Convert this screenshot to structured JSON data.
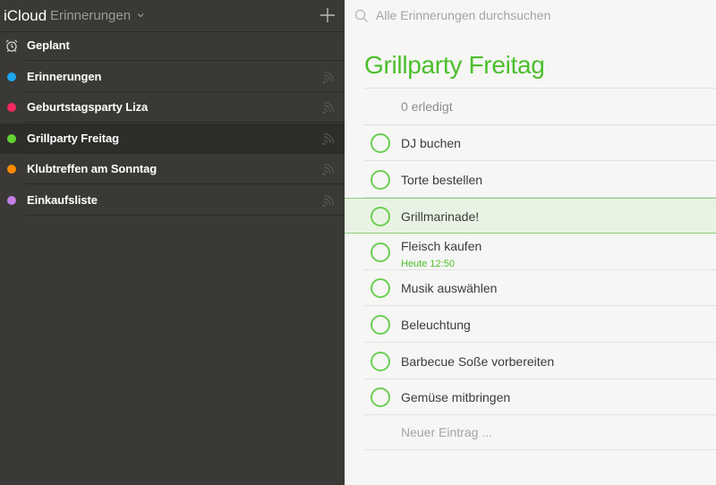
{
  "header": {
    "app_name": "iCloud",
    "app_section": "Erinnerungen"
  },
  "sidebar": {
    "scheduled_label": "Geplant",
    "lists": [
      {
        "label": "Erinnerungen",
        "color": "#1ea8ef"
      },
      {
        "label": "Geburtstagsparty Liza",
        "color": "#f2285f"
      },
      {
        "label": "Grillparty Freitag",
        "color": "#62d233"
      },
      {
        "label": "Klubtreffen am Sonntag",
        "color": "#ff8a00"
      },
      {
        "label": "Einkaufsliste",
        "color": "#c27ee3"
      }
    ],
    "selected_list": "Grillparty Freitag"
  },
  "search": {
    "placeholder": "Alle Erinnerungen durchsuchen"
  },
  "main": {
    "title": "Grillparty Freitag",
    "completed_count": "0 erledigt",
    "tasks": [
      {
        "label": "DJ buchen"
      },
      {
        "label": "Torte bestellen"
      },
      {
        "label": "Grillmarinade!",
        "selected": true
      },
      {
        "label": "Fleisch kaufen",
        "due": "Heute 12:50"
      },
      {
        "label": "Musik auswählen"
      },
      {
        "label": "Beleuchtung"
      },
      {
        "label": "Barbecue Soße vorbereiten"
      },
      {
        "label": "Gemüse mitbringen"
      }
    ],
    "new_entry_placeholder": "Neuer Eintrag ..."
  },
  "colors": {
    "accent": "#4cbf2c",
    "sidebar_bg": "#3a3935",
    "content_bg": "#f6f6f5"
  }
}
